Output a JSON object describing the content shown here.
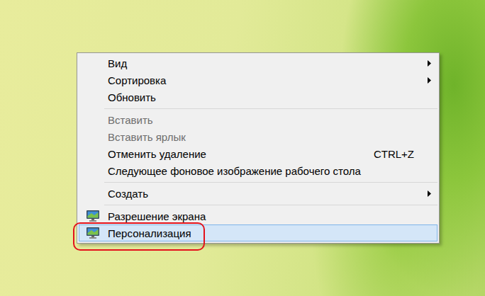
{
  "desktop": {
    "context_menu": {
      "items": [
        {
          "kind": "submenu",
          "label": "Вид",
          "disabled": false,
          "selected": false,
          "annotated": false,
          "shortcut": ""
        },
        {
          "kind": "submenu",
          "label": "Сортировка",
          "disabled": false,
          "selected": false,
          "annotated": false,
          "shortcut": ""
        },
        {
          "kind": "command",
          "label": "Обновить",
          "disabled": false,
          "selected": false,
          "annotated": false,
          "shortcut": ""
        },
        {
          "kind": "separator",
          "label": "",
          "disabled": false,
          "selected": false,
          "annotated": false,
          "shortcut": ""
        },
        {
          "kind": "command",
          "label": "Вставить",
          "disabled": true,
          "selected": false,
          "annotated": false,
          "shortcut": ""
        },
        {
          "kind": "command",
          "label": "Вставить ярлык",
          "disabled": true,
          "selected": false,
          "annotated": false,
          "shortcut": ""
        },
        {
          "kind": "command",
          "label": "Отменить удаление",
          "disabled": false,
          "selected": false,
          "annotated": false,
          "shortcut": "CTRL+Z"
        },
        {
          "kind": "command",
          "label": "Следующее фоновое изображение рабочего стола",
          "disabled": false,
          "selected": false,
          "annotated": false,
          "shortcut": ""
        },
        {
          "kind": "separator",
          "label": "",
          "disabled": false,
          "selected": false,
          "annotated": false,
          "shortcut": ""
        },
        {
          "kind": "submenu",
          "label": "Создать",
          "disabled": false,
          "selected": false,
          "annotated": false,
          "shortcut": ""
        },
        {
          "kind": "separator",
          "label": "",
          "disabled": false,
          "selected": false,
          "annotated": false,
          "shortcut": ""
        },
        {
          "kind": "display",
          "label": "Разрешение экрана",
          "disabled": false,
          "selected": false,
          "annotated": false,
          "shortcut": ""
        },
        {
          "kind": "display",
          "label": "Персонализация",
          "disabled": false,
          "selected": true,
          "annotated": true,
          "shortcut": ""
        }
      ]
    }
  }
}
